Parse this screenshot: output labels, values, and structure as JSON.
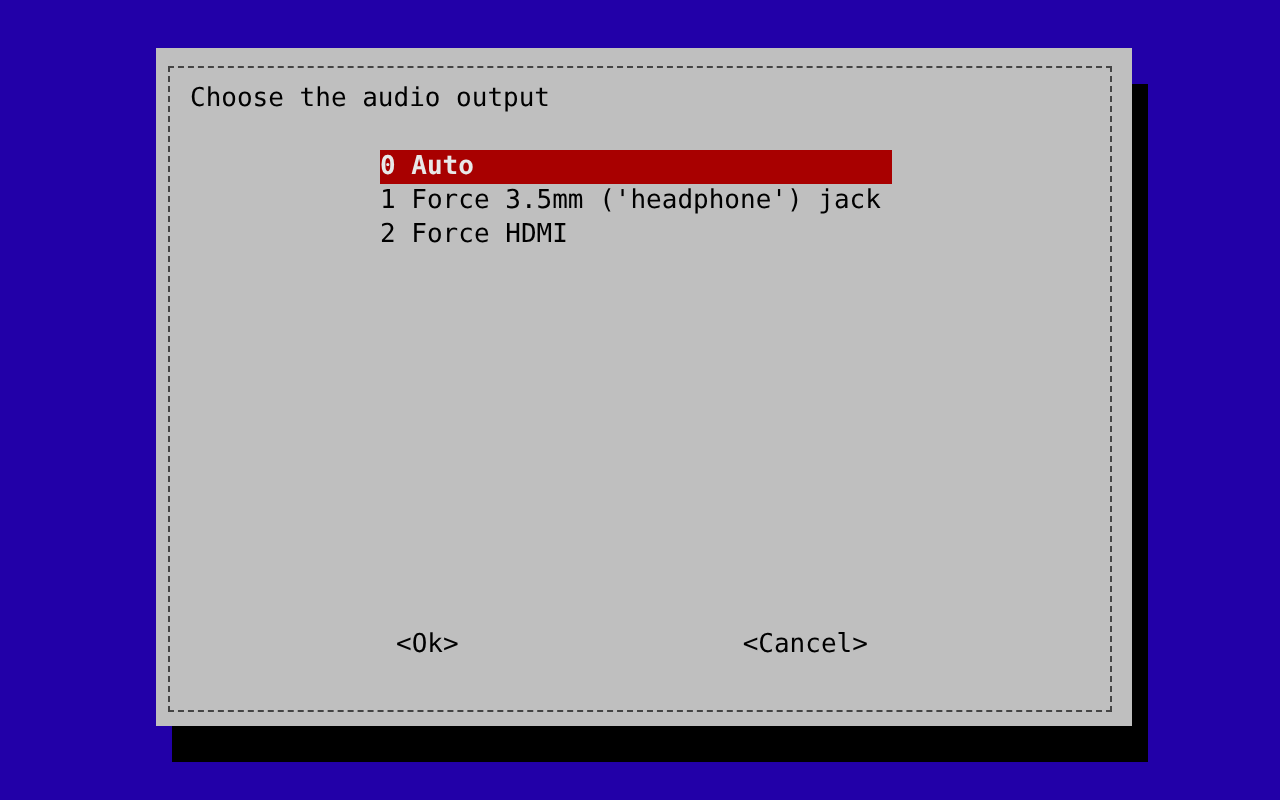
{
  "dialog": {
    "prompt": "Choose the audio output",
    "menu": [
      {
        "label": "0 Auto",
        "selected": true
      },
      {
        "label": "1 Force 3.5mm ('headphone') jack",
        "selected": false
      },
      {
        "label": "2 Force HDMI",
        "selected": false
      }
    ],
    "buttons": [
      {
        "label": "<Ok>",
        "selected": false
      },
      {
        "label": "<Cancel>",
        "selected": false
      }
    ]
  }
}
